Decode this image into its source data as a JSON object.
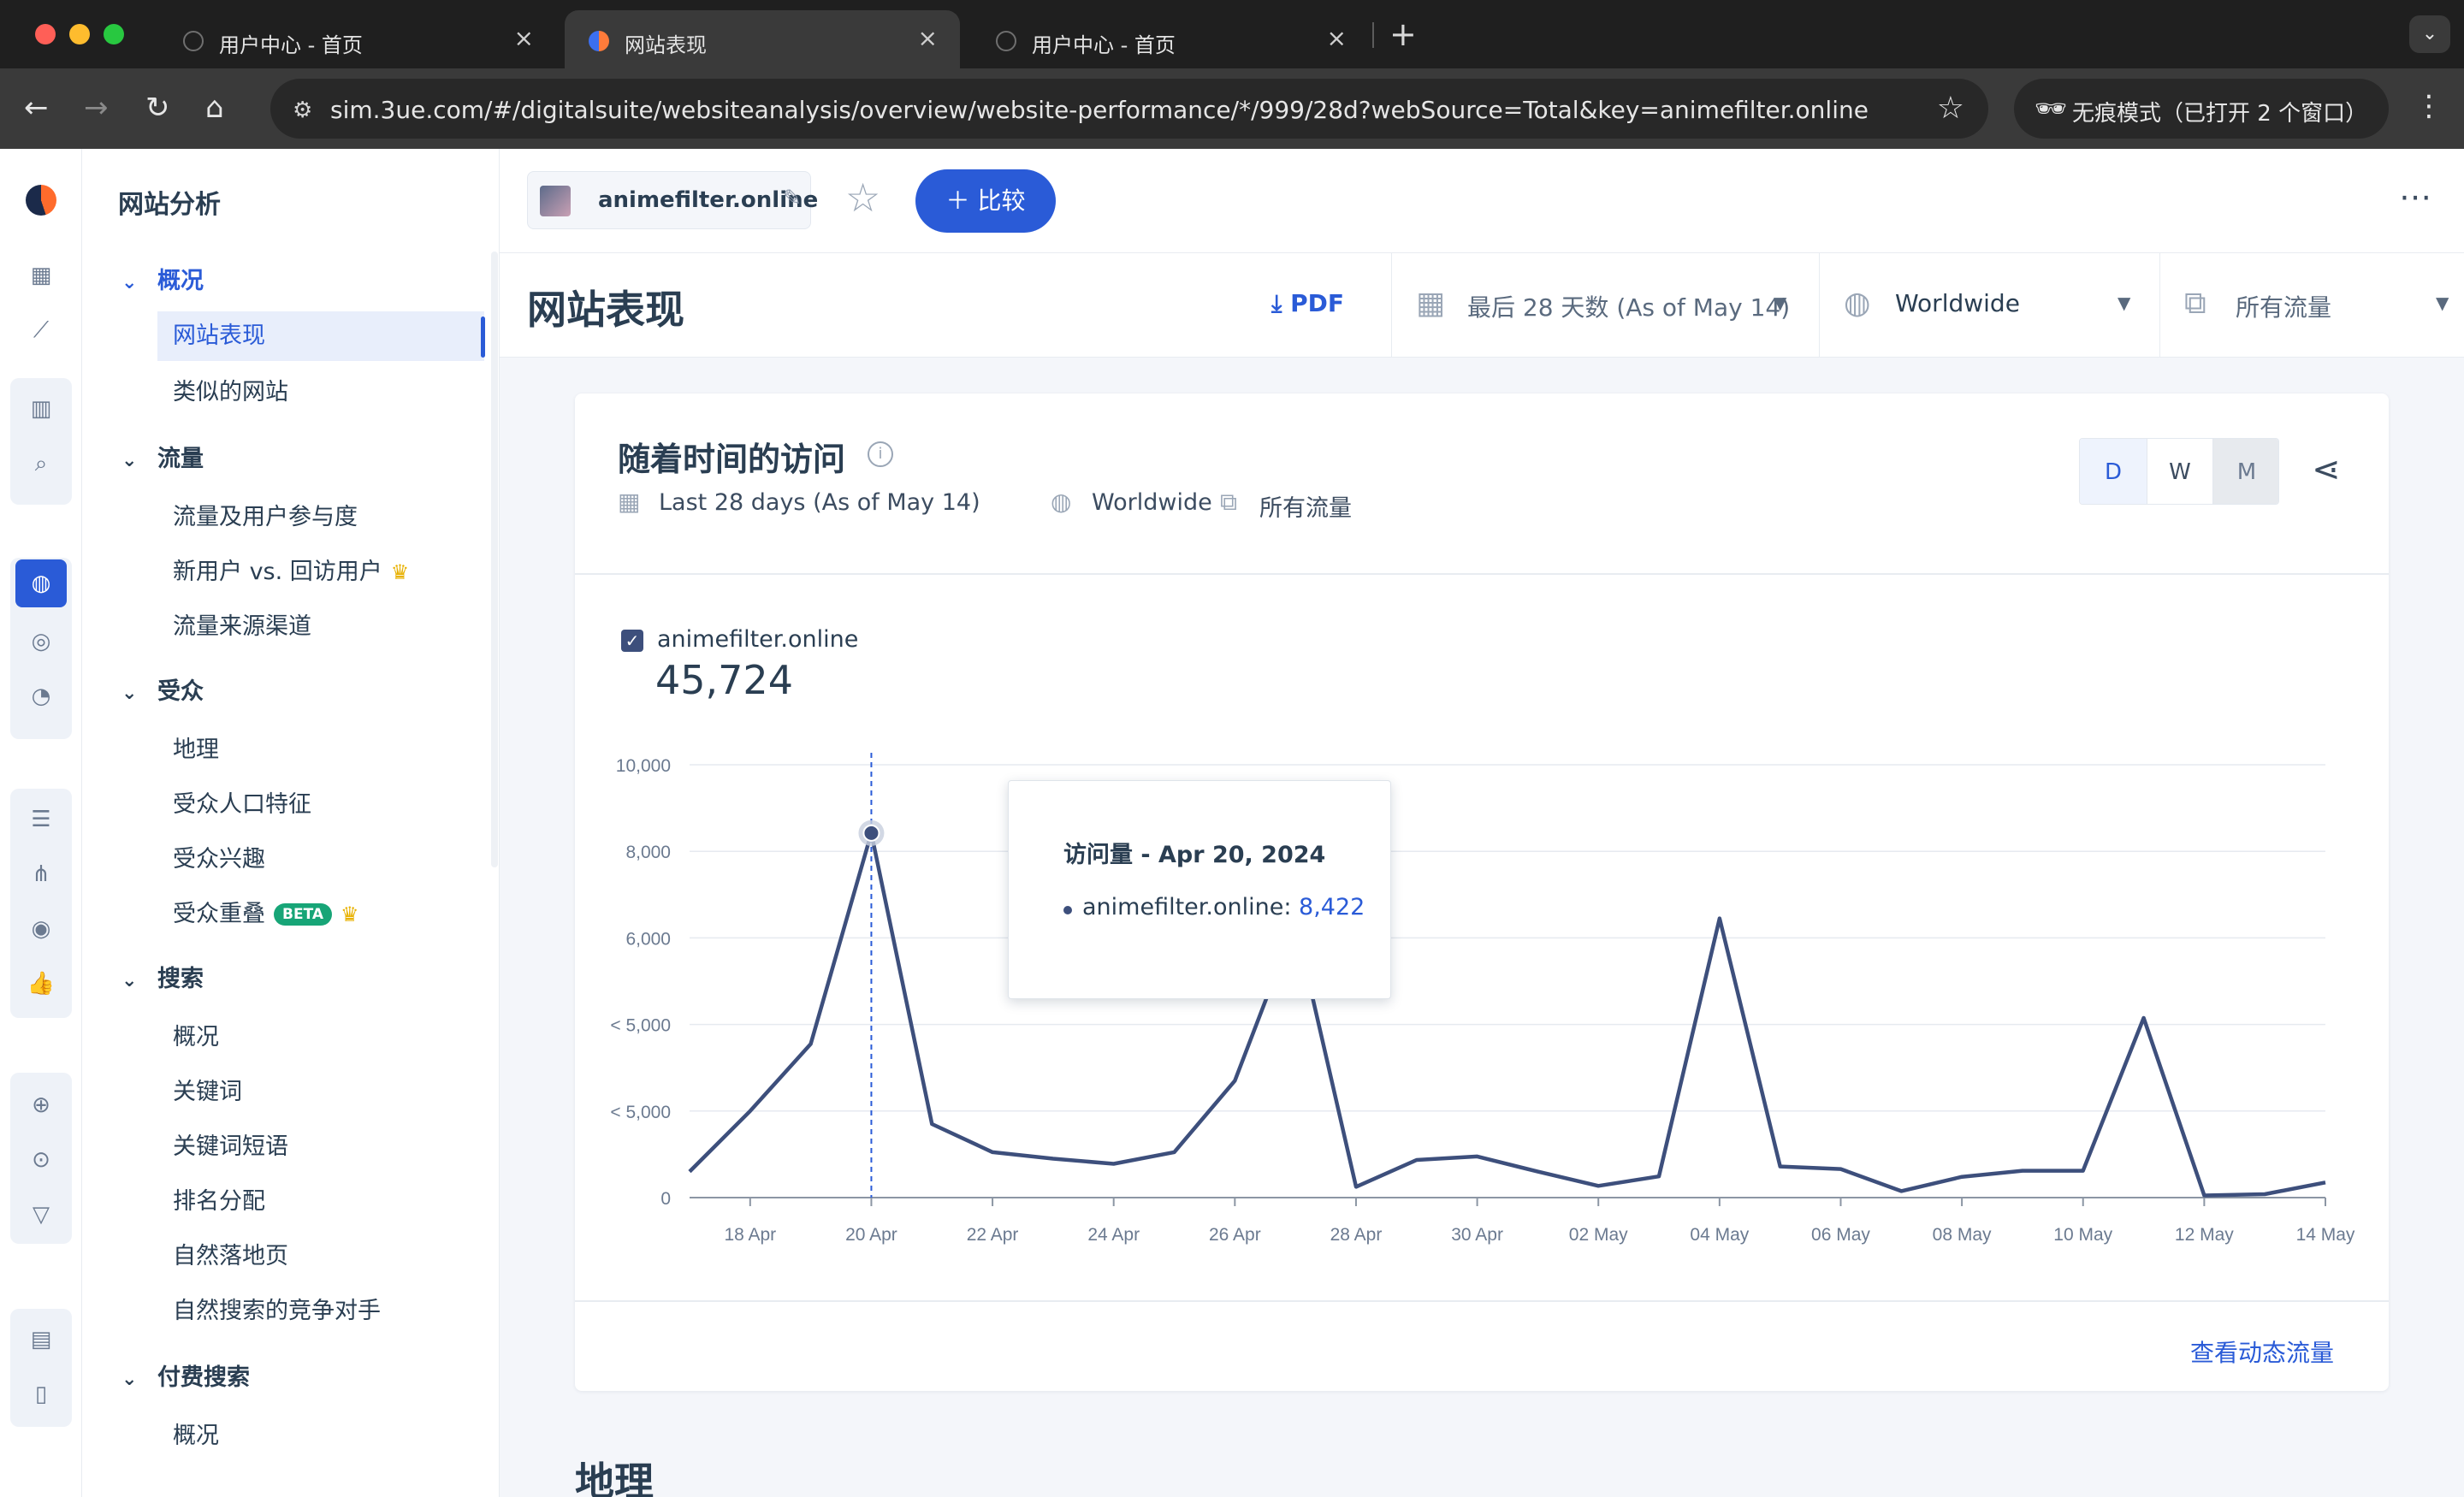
{
  "browser": {
    "tabs": [
      {
        "title": "用户中心 - 首页",
        "active": false
      },
      {
        "title": "网站表现",
        "active": true
      },
      {
        "title": "用户中心 - 首页",
        "active": false
      }
    ],
    "url": "sim.3ue.com/#/digitalsuite/websiteanalysis/overview/website-performance/*/999/28d?webSource=Total&key=animefilter.online",
    "incognito_label": "无痕模式（已打开 2 个窗口）",
    "icons": {
      "back": "back-arrow-icon",
      "forward": "forward-arrow-icon",
      "reload": "reload-icon",
      "home": "home-icon",
      "star": "bookmark-star-icon",
      "incognito": "incognito-icon",
      "menu": "kebab-menu-icon"
    }
  },
  "sidebar": {
    "title": "网站分析",
    "sections": [
      {
        "label": "概况",
        "highlight": true,
        "items": [
          {
            "label": "网站表现",
            "active": true
          },
          {
            "label": "类似的网站"
          }
        ]
      },
      {
        "label": "流量",
        "items": [
          {
            "label": "流量及用户参与度"
          },
          {
            "label": "新用户 vs. 回访用户",
            "crown": true
          },
          {
            "label": "流量来源渠道"
          }
        ]
      },
      {
        "label": "受众",
        "items": [
          {
            "label": "地理"
          },
          {
            "label": "受众人口特征"
          },
          {
            "label": "受众兴趣"
          },
          {
            "label": "受众重叠",
            "beta": "BETA",
            "crown": true
          }
        ]
      },
      {
        "label": "搜索",
        "items": [
          {
            "label": "概况"
          },
          {
            "label": "关键词"
          },
          {
            "label": "关键词短语"
          },
          {
            "label": "排名分配"
          },
          {
            "label": "自然落地页"
          },
          {
            "label": "自然搜索的竞争对手"
          }
        ]
      },
      {
        "label": "付费搜索",
        "items": [
          {
            "label": "概况"
          }
        ]
      }
    ]
  },
  "header": {
    "site": "animefilter.online",
    "compare_label": "比较",
    "page_title": "网站表现",
    "pdf_label": "PDF",
    "date_filter": "最后 28 天数 (As of May 14)",
    "region_filter": "Worldwide",
    "traffic_filter": "所有流量"
  },
  "card": {
    "title": "随着时间的访问",
    "meta_date": "Last 28 days (As of May 14)",
    "meta_region": "Worldwide",
    "meta_traffic": "所有流量",
    "granularity": [
      "D",
      "W",
      "M"
    ],
    "legend_site": "animefilter.online",
    "total": "45,724",
    "tooltip_title": "访问量 - Apr 20, 2024",
    "tooltip_site": "animefilter.online:",
    "tooltip_value": "8,422",
    "link_label": "查看动态流量"
  },
  "next_section": "地理",
  "chart_data": {
    "type": "line",
    "series": [
      {
        "name": "animefilter.online",
        "color": "#3d4f7c"
      }
    ],
    "x": [
      "Apr 17",
      "Apr 18",
      "Apr 19",
      "Apr 20",
      "Apr 21",
      "Apr 22",
      "Apr 23",
      "Apr 24",
      "Apr 25",
      "Apr 26",
      "Apr 27",
      "Apr 28",
      "Apr 29",
      "Apr 30",
      "May 01",
      "May 02",
      "May 03",
      "May 04",
      "May 05",
      "May 06",
      "May 07",
      "May 08",
      "May 09",
      "May 10",
      "May 11",
      "May 12",
      "May 13",
      "May 14"
    ],
    "values": [
      600,
      2000,
      3550,
      8422,
      1700,
      1050,
      900,
      780,
      1050,
      2700,
      6350,
      250,
      870,
      950,
      600,
      270,
      490,
      6450,
      720,
      660,
      150,
      480,
      620,
      620,
      4150,
      50,
      80,
      350
    ],
    "x_tick_labels": [
      "18 Apr",
      "20 Apr",
      "22 Apr",
      "24 Apr",
      "26 Apr",
      "28 Apr",
      "30 Apr",
      "02 May",
      "04 May",
      "06 May",
      "08 May",
      "10 May",
      "12 May",
      "14 May"
    ],
    "y_tick_labels": [
      "0",
      "< 5,000",
      "< 5,000",
      "6,000",
      "8,000",
      "10,000"
    ],
    "ylim": [
      0,
      10000
    ],
    "highlight": {
      "x": "Apr 20",
      "value": 8422
    },
    "grid": true
  }
}
